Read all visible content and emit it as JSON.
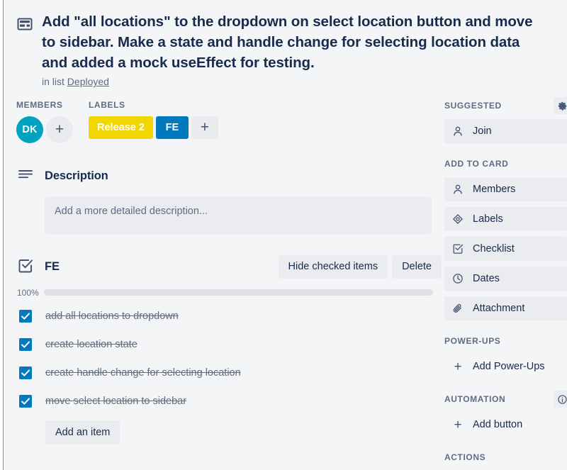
{
  "card": {
    "icon": "card-template-icon",
    "title": "Add \"all locations\" to the dropdown on select location button and move to sidebar. Make a state and handle change for selecting location data and added a mock useEffect for testing.",
    "in_list_prefix": "in list",
    "list_name": "Deployed"
  },
  "members": {
    "heading": "MEMBERS",
    "avatars": [
      {
        "initials": "DK",
        "color": "#00a3bf"
      }
    ],
    "add_label": "+"
  },
  "labels": {
    "heading": "LABELS",
    "chips": [
      {
        "text": "Release 2",
        "color": "#f2d600"
      },
      {
        "text": "FE",
        "color": "#0079bf"
      }
    ],
    "add_label": "+"
  },
  "description": {
    "icon": "description-lines-icon",
    "heading": "Description",
    "placeholder": "Add a more detailed description..."
  },
  "checklist": {
    "icon": "checklist-icon",
    "title": "FE",
    "hide_checked_label": "Hide checked items",
    "delete_label": "Delete",
    "progress_percent_text": "100%",
    "progress_percent": 100,
    "progress_color": "#61bd4f",
    "items": [
      {
        "text": "add all locations to dropdown",
        "checked": true
      },
      {
        "text": "create location state",
        "checked": true
      },
      {
        "text": "create handle change for selecting location",
        "checked": true
      },
      {
        "text": "move select location to sidebar",
        "checked": true
      }
    ],
    "add_item_label": "Add an item"
  },
  "sidebar": {
    "groups": [
      {
        "heading": "SUGGESTED",
        "heading_icon": "gear-icon",
        "items": [
          {
            "label": "Join",
            "icon": "person-icon",
            "style": "filled"
          }
        ]
      },
      {
        "heading": "ADD TO CARD",
        "items": [
          {
            "label": "Members",
            "icon": "person-icon",
            "style": "filled"
          },
          {
            "label": "Labels",
            "icon": "label-tag-icon",
            "style": "filled"
          },
          {
            "label": "Checklist",
            "icon": "checklist-icon",
            "style": "filled"
          },
          {
            "label": "Dates",
            "icon": "clock-icon",
            "style": "filled"
          },
          {
            "label": "Attachment",
            "icon": "paperclip-icon",
            "style": "filled"
          }
        ]
      },
      {
        "heading": "POWER-UPS",
        "items": [
          {
            "label": "Add Power-Ups",
            "icon": "plus-icon",
            "style": "plain"
          }
        ]
      },
      {
        "heading": "AUTOMATION",
        "heading_icon": "info-icon",
        "items": [
          {
            "label": "Add button",
            "icon": "plus-icon",
            "style": "plain"
          }
        ]
      },
      {
        "heading": "ACTIONS",
        "items": []
      }
    ]
  },
  "colors": {
    "modal_bg": "#f4f5f7",
    "text_primary": "#172b4d",
    "text_muted": "#5e6c84",
    "button_bg": "#eaecf0",
    "checkbox_blue": "#0079bf",
    "progress_green": "#61bd4f"
  }
}
